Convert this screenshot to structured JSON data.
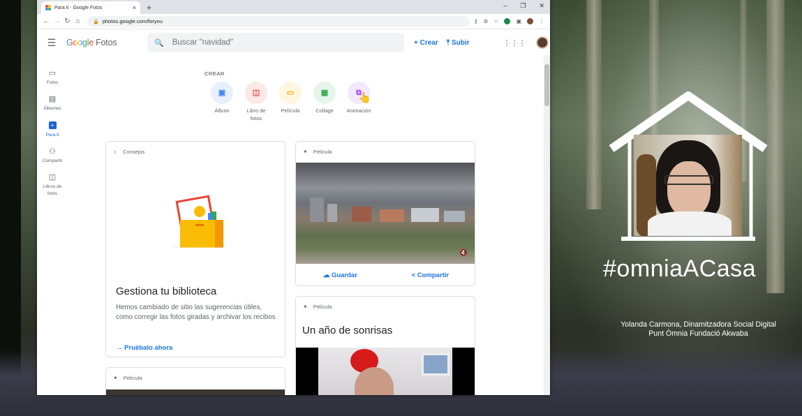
{
  "browser": {
    "tab_title": "Para ti - Google Fotos",
    "tab_close": "×",
    "new_tab": "+",
    "url": "photos.google.com/foryou",
    "window_controls": [
      "–",
      "❐",
      "✕"
    ]
  },
  "app": {
    "logo_google": "Google",
    "logo_product": "Fotos",
    "search_placeholder": "Buscar \"navidad\"",
    "create_btn": "+ Crear",
    "upload_btn": "⤒ Subir"
  },
  "sidebar": {
    "items": [
      {
        "label": "Fotos",
        "icon": "🖼"
      },
      {
        "label": "Álbumes",
        "icon": "▤"
      },
      {
        "label": "Para ti",
        "icon": "✦"
      },
      {
        "label": "Compartir",
        "icon": "👥"
      },
      {
        "label": "Libros de fotos",
        "icon": "📖"
      }
    ]
  },
  "create": {
    "heading": "CREAR",
    "items": [
      {
        "label": "Álbum",
        "color": "#e8f0fe",
        "fg": "#4285f4",
        "glyph": "▣"
      },
      {
        "label": "Libro de fotos",
        "color": "#fce8e6",
        "fg": "#ea4335",
        "glyph": "📖"
      },
      {
        "label": "Película",
        "color": "#fef7e0",
        "fg": "#f9ab00",
        "glyph": "▭"
      },
      {
        "label": "Collage",
        "color": "#e6f4ea",
        "fg": "#34a853",
        "glyph": "▦"
      },
      {
        "label": "Animación",
        "color": "#f3e8fd",
        "fg": "#a142f4",
        "glyph": "⧉"
      }
    ]
  },
  "cards": {
    "tips": {
      "header": "Consejos",
      "title": "Gestiona tu biblioteca",
      "desc": "Hemos cambiado de sitio las sugerencias útiles, como corregir las fotos giradas y archivar los recibos",
      "link": "→ Pruébalo ahora"
    },
    "movie1": {
      "header": "Película",
      "save": "Guardar",
      "share": "Compartir"
    },
    "movie2": {
      "header": "Película",
      "title": "Un año de sonrisas"
    },
    "movie3": {
      "header": "Película"
    }
  },
  "overlay": {
    "hashtag": "#omniaACasa",
    "credit_line1": "Yolanda Carmona, Dinamitzadora Social Digital",
    "credit_line2": "Punt Òmnia Fundació Akwaba"
  }
}
